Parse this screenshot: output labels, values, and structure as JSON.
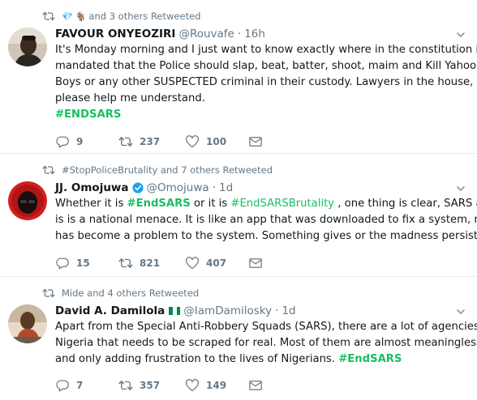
{
  "tweets": [
    {
      "context": {
        "emojis": [
          "💎",
          "🐐"
        ],
        "text": "and 3 others Retweeted"
      },
      "author": {
        "name": "FAVOUR ONYEOZIRI",
        "handle": "@Rouvafe",
        "dot": "·",
        "time": "16h"
      },
      "body_lines": [
        "It's Monday morning and I just want to know exactly where in the constitution it is",
        "mandated that the Police should slap, beat, batter, shoot, maim and Kill Yahoo",
        "Boys or any other SUSPECTED criminal in their custody. Lawyers in the house,",
        "please help me understand."
      ],
      "hashtag": "#ENDSARS",
      "stats": {
        "replies": "9",
        "retweets": "237",
        "likes": "100"
      }
    },
    {
      "context": {
        "text": "#StopPoliceBrutality and 7 others Retweeted"
      },
      "author": {
        "name": "JJ. Omojuwa",
        "handle": "@Omojuwa",
        "dot": "·",
        "time": "1d"
      },
      "body": {
        "l1a": "Whether it is ",
        "l1tag1": "#EndSARS",
        "l1b": " or it is ",
        "l1tag2": "#EndSARSBrutality",
        "l1c": " , one thing is clear, SARS as it",
        "l2": "is is a national menace. It is like an app that was downloaded to fix a system, now",
        "l3": "has become a problem to the system. Something gives or the madness persists."
      },
      "stats": {
        "replies": "15",
        "retweets": "821",
        "likes": "407"
      }
    },
    {
      "context": {
        "text": "Mide and 4 others Retweeted"
      },
      "author": {
        "name": "David A. Damilola",
        "handle": "@IamDamilosky",
        "dot": "·",
        "time": "1d"
      },
      "body": {
        "l1": "Apart from the Special Anti-Robbery Squads (SARS), there are a lot of agencies in",
        "l2": "Nigeria that needs to be scraped for real. Most of them are almost meaningless,",
        "l3a": "and only adding frustration to the lives of Nigerians. ",
        "l3tag": "#EndSARS"
      },
      "stats": {
        "replies": "7",
        "retweets": "357",
        "likes": "149"
      }
    }
  ],
  "colors": {
    "hashtag": "#17bf63",
    "muted": "#657786",
    "text": "#14171a",
    "verified": "#1da1f2",
    "divider": "#e6ecf0"
  },
  "icons": [
    "retweet-icon",
    "reply-icon",
    "like-icon",
    "dm-icon",
    "chevron-down-icon",
    "verified-badge-icon",
    "nigeria-flag-icon"
  ]
}
